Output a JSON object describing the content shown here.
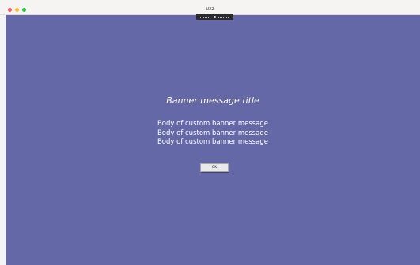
{
  "window": {
    "title": "U22"
  },
  "traffic_lights": {
    "close_color": "#ff5f57",
    "minimize_color": "#febc2e",
    "maximize_color": "#28c840"
  },
  "toolbar": {
    "icon": "pin-icon"
  },
  "banner": {
    "title": "Banner message title",
    "body": [
      "Body of custom banner message",
      "Body of custom banner message",
      "Body of custom banner message"
    ],
    "ok_label": "OK",
    "background_color": "#6468a6"
  }
}
